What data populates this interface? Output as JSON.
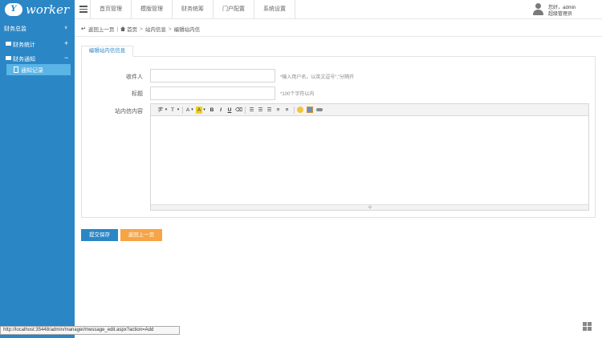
{
  "app": {
    "logo_badge": "Y",
    "logo_word": "worker"
  },
  "nav": {
    "tabs": [
      "首页管理",
      "模版管理",
      "财务统筹",
      "门户配置",
      "系统设置"
    ]
  },
  "user": {
    "name": "您好，admin",
    "role": "超级管理员"
  },
  "sidebar": {
    "header": "财务总监",
    "groups": [
      {
        "label": "财务统计",
        "sign": "+"
      },
      {
        "label": "财务通知",
        "sign": "−"
      }
    ],
    "active_item": "通知记录"
  },
  "breadcrumb": {
    "back_label": "返回上一页",
    "items": [
      "首页",
      "站内信息",
      "编辑站内信"
    ]
  },
  "form": {
    "tab_label": "编辑站内信信息",
    "recipient": {
      "label": "收件人",
      "value": "",
      "hint": "*输入用户名，以英文逗号“,”分隔开"
    },
    "title": {
      "label": "标题",
      "value": "",
      "hint": "*100个字符以内"
    },
    "content": {
      "label": "站内信内容"
    }
  },
  "editor": {
    "toolbar": [
      "字",
      "T",
      "A",
      "A",
      "B",
      "I",
      "U"
    ]
  },
  "buttons": {
    "submit": "提交保存",
    "back": "返回上一页"
  },
  "statusbar": {
    "url": "http://localhost:35448/admin/manager/message_edit.aspx?action=Add"
  },
  "colors": {
    "brand": "#2b86c5",
    "active_item": "#5ab4e6",
    "back_button": "#f7a445"
  }
}
